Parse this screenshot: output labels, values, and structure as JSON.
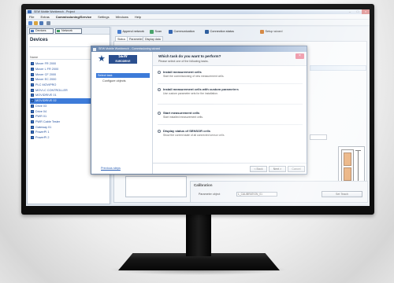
{
  "colors": {
    "accent": "#3d7bd9",
    "dialog_title": "#6c89b0",
    "dialog_close": "#e8738a",
    "logo": "#2b4f8f",
    "device_cell": "#e0893a",
    "window_close": "#c94a4a"
  },
  "window": {
    "title": "SEW Mobile Workbench - Project",
    "controls": {
      "minimize": "–",
      "maximize": "□",
      "close": "×"
    }
  },
  "menu": [
    "File",
    "Extras",
    "Commissioning/Service",
    "Settings",
    "Windows",
    "Help"
  ],
  "left_pane": {
    "tabs": [
      "Devices",
      "Network"
    ],
    "title": "Devices",
    "column_header": "Name",
    "items": [
      {
        "label": "Mover FR 2000"
      },
      {
        "label": "Mover L FR 2000"
      },
      {
        "label": "Mover CF 2000"
      },
      {
        "label": "Mover EC 2000"
      },
      {
        "label": "PLC MOVIPRO"
      },
      {
        "label": "MOVI-C CONTROLLER"
      },
      {
        "label": "MOVIDRIVE 01"
      },
      {
        "label": "MOVIDRIVE 02",
        "selected": true
      },
      {
        "label": "Drive 03"
      },
      {
        "label": "Drive 04"
      },
      {
        "label": "PWR 01"
      },
      {
        "label": "PWR Cable Tester"
      },
      {
        "label": "Gateway 01"
      },
      {
        "label": "PowerPI 1"
      },
      {
        "label": "PowerPI 2"
      }
    ]
  },
  "main": {
    "toolbar": [
      "Append network",
      "Scan",
      "Communication",
      "Connection status",
      "Setup wizard"
    ],
    "tabs": [
      "Status",
      "Parameter",
      "Display data"
    ],
    "calibration": {
      "label": "Calibration",
      "param_label": "Parameter object",
      "param_value": "L_CALIBRATION_01",
      "button": "Set Teach"
    }
  },
  "dialog": {
    "title": "SEW Mobile Workbench - Commissioning wizard",
    "logo": {
      "line1": "SEW",
      "line2": "EURODRIVE"
    },
    "nav": [
      {
        "label": "Select task",
        "selected": true
      },
      {
        "label": "Configure objects"
      }
    ],
    "header": {
      "title": "Which task do you want to perform?",
      "subtitle": "Please select one of the following tasks."
    },
    "close": "×",
    "options": [
      {
        "title": "Install measurement cells",
        "desc": "Start the commissioning of new measurement cells."
      },
      {
        "title": "Install measurement cells with custom parameters",
        "desc": "Use custom parameter sets for the installation."
      },
      {
        "title": "Start measurement cells",
        "desc": "Start installed measurement cells."
      },
      {
        "title": "Display status of SENSOR cells",
        "desc": "Show the current state of all connected sensor cells."
      }
    ],
    "previous_link": "Previous steps",
    "buttons": {
      "back": "< Back",
      "next": "Next >",
      "cancel": "Cancel"
    }
  }
}
